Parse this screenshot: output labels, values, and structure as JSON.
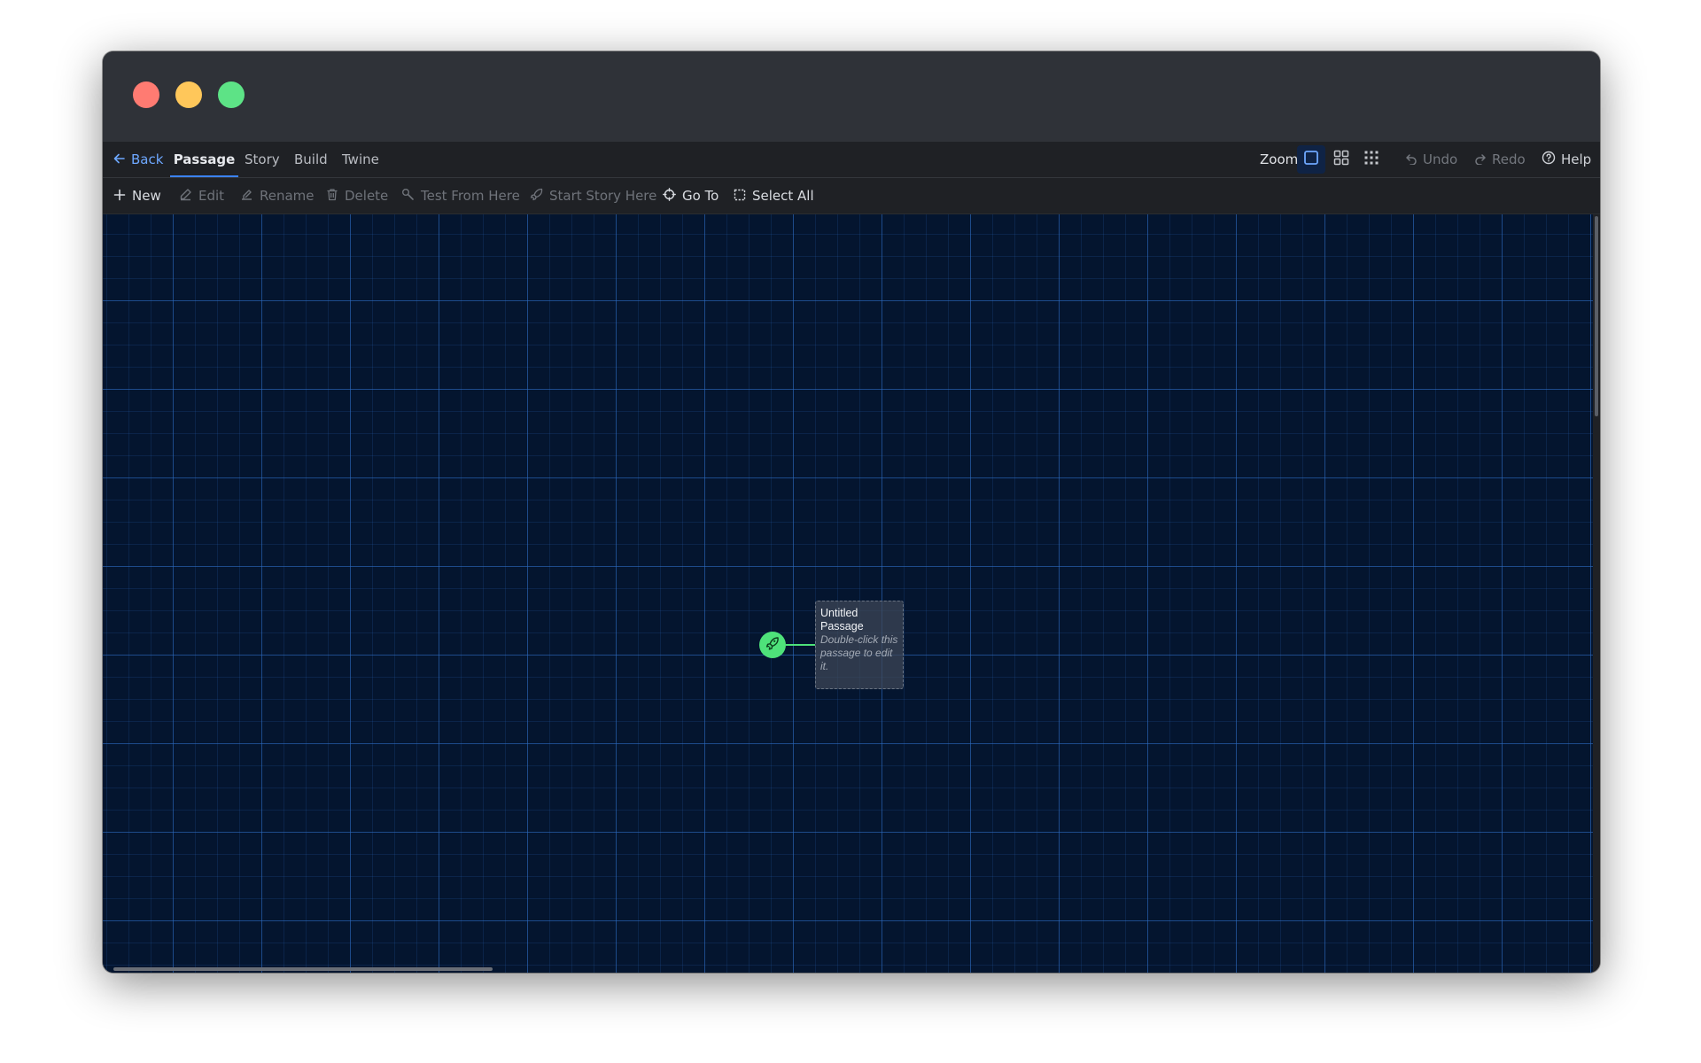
{
  "window": {
    "controls": [
      "close",
      "minimize",
      "maximize"
    ]
  },
  "tabbar": {
    "back_label": "Back",
    "tabs": [
      {
        "label": "Passage",
        "active": true
      },
      {
        "label": "Story",
        "active": false
      },
      {
        "label": "Build",
        "active": false
      },
      {
        "label": "Twine",
        "active": false
      }
    ],
    "zoom_label": "Zoom",
    "zoom_options": [
      {
        "icon": "single-square-icon",
        "active": true
      },
      {
        "icon": "four-squares-icon",
        "active": false
      },
      {
        "icon": "nine-dots-icon",
        "active": false
      }
    ],
    "undo_label": "Undo",
    "redo_label": "Redo",
    "help_label": "Help"
  },
  "toolbar": {
    "new_label": "New",
    "edit_label": "Edit",
    "rename_label": "Rename",
    "delete_label": "Delete",
    "test_label": "Test From Here",
    "start_label": "Start Story Here",
    "goto_label": "Go To",
    "selectall_label": "Select All"
  },
  "canvas": {
    "passages": [
      {
        "title": "Untitled Passage",
        "excerpt": "Double-click this passage to edit it.",
        "is_start": true
      }
    ]
  },
  "colors": {
    "accent": "#3b82f6",
    "start_badge": "#4ee27a",
    "canvas_bg": "#04152f"
  }
}
